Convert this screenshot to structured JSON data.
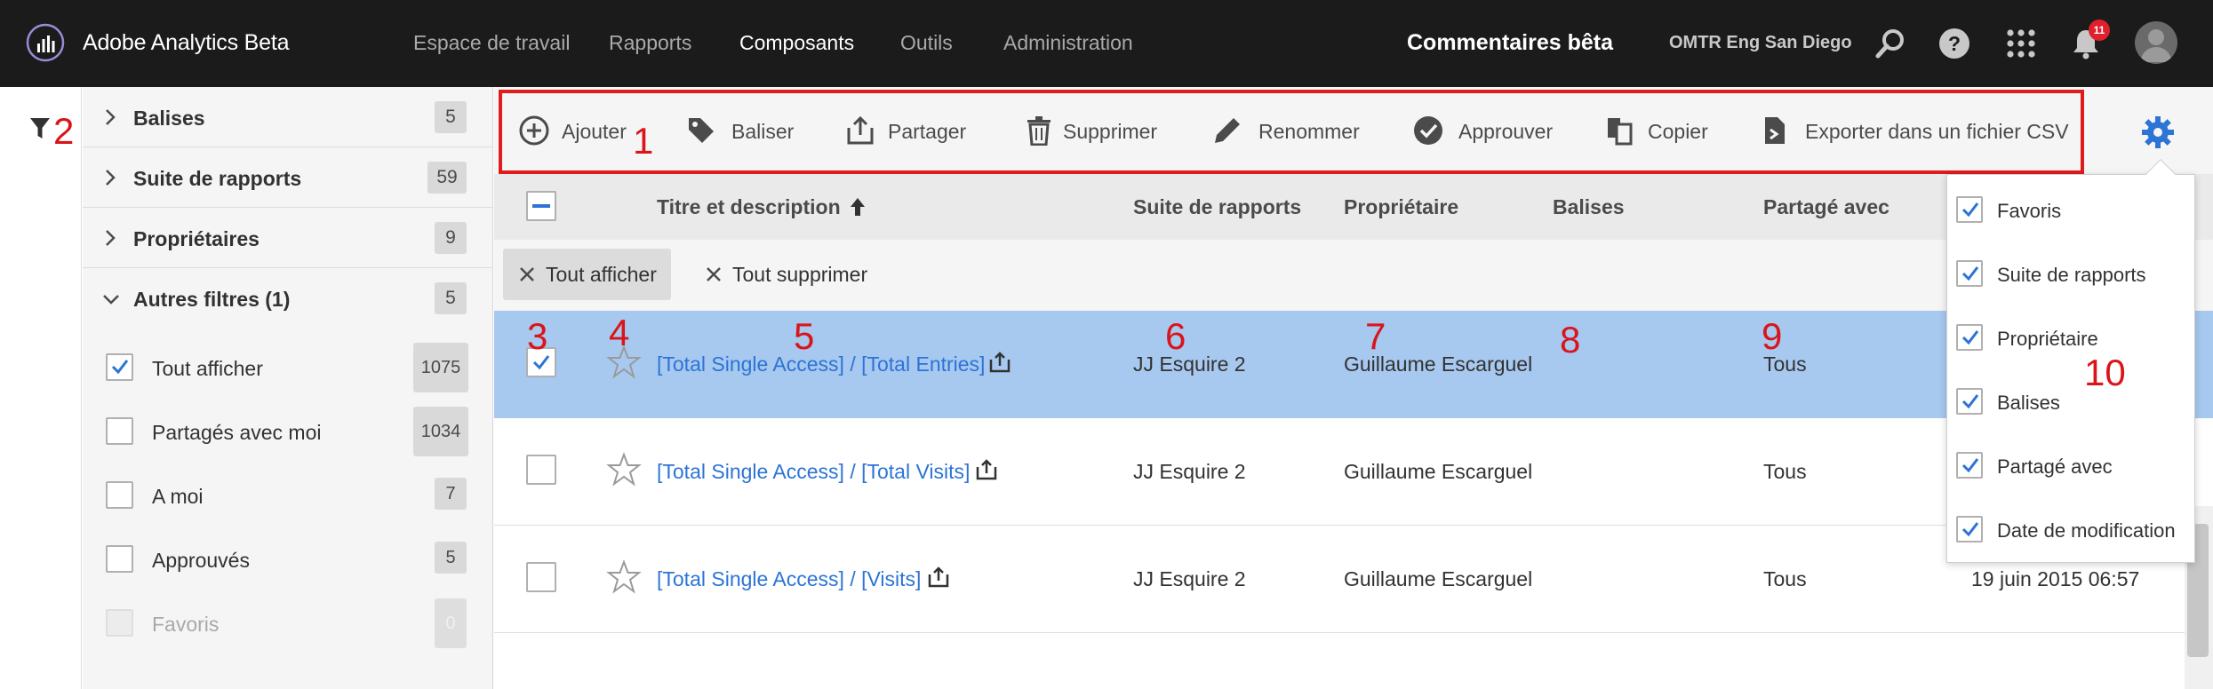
{
  "app": {
    "title": "Adobe Analytics Beta"
  },
  "topnav": {
    "items": [
      "Espace de travail",
      "Rapports",
      "Composants",
      "Outils",
      "Administration"
    ],
    "active": "Composants",
    "beta_feedback": "Commentaires bêta",
    "org": "OMTR Eng San Diego",
    "notification_count": "11"
  },
  "callouts": [
    "1",
    "2",
    "3",
    "4",
    "5",
    "6",
    "7",
    "8",
    "9",
    "10"
  ],
  "filters": {
    "facets": [
      {
        "label": "Balises",
        "count": "5"
      },
      {
        "label": "Suite de rapports",
        "count": "59"
      },
      {
        "label": "Propriétaires",
        "count": "9"
      },
      {
        "label": "Autres filtres (1)",
        "count": "5"
      }
    ],
    "options": [
      {
        "label": "Tout afficher",
        "count": "1075",
        "checked": true
      },
      {
        "label": "Partagés avec moi",
        "count": "1034",
        "checked": false
      },
      {
        "label": "A moi",
        "count": "7",
        "checked": false
      },
      {
        "label": "Approuvés",
        "count": "5",
        "checked": false
      },
      {
        "label": "Favoris",
        "count": "0",
        "checked": false,
        "disabled": true
      }
    ]
  },
  "toolbar": {
    "add": "Ajouter",
    "tag": "Baliser",
    "share": "Partager",
    "delete": "Supprimer",
    "rename": "Renommer",
    "approve": "Approuver",
    "copy": "Copier",
    "export": "Exporter dans un fichier CSV"
  },
  "table": {
    "headers": {
      "title": "Titre et description",
      "suite": "Suite de rapports",
      "owner": "Propriétaire",
      "tags": "Balises",
      "shared": "Partagé avec"
    },
    "chips": {
      "show_all": "Tout afficher",
      "clear_all": "Tout supprimer"
    },
    "rows": [
      {
        "title": "[Total Single Access] / [Total Entries]",
        "suite": "JJ Esquire 2",
        "owner": "Guillaume Escarguel",
        "tags": "",
        "shared": "Tous",
        "modified": "",
        "selected": true
      },
      {
        "title": "[Total Single Access] / [Total Visits]",
        "suite": "JJ Esquire 2",
        "owner": "Guillaume Escarguel",
        "tags": "",
        "shared": "Tous",
        "modified": "",
        "selected": false
      },
      {
        "title": "[Total Single Access] / [Visits]",
        "suite": "JJ Esquire 2",
        "owner": "Guillaume Escarguel",
        "tags": "",
        "shared": "Tous",
        "modified": "19 juin 2015 06:57",
        "selected": false
      }
    ]
  },
  "column_picker": {
    "items": [
      "Favoris",
      "Suite de rapports",
      "Propriétaire",
      "Balises",
      "Partagé avec",
      "Date de modification"
    ]
  },
  "colors": {
    "accent": "#2c74d5",
    "selected_row": "#a7c8ef",
    "callout": "#d9151a"
  }
}
